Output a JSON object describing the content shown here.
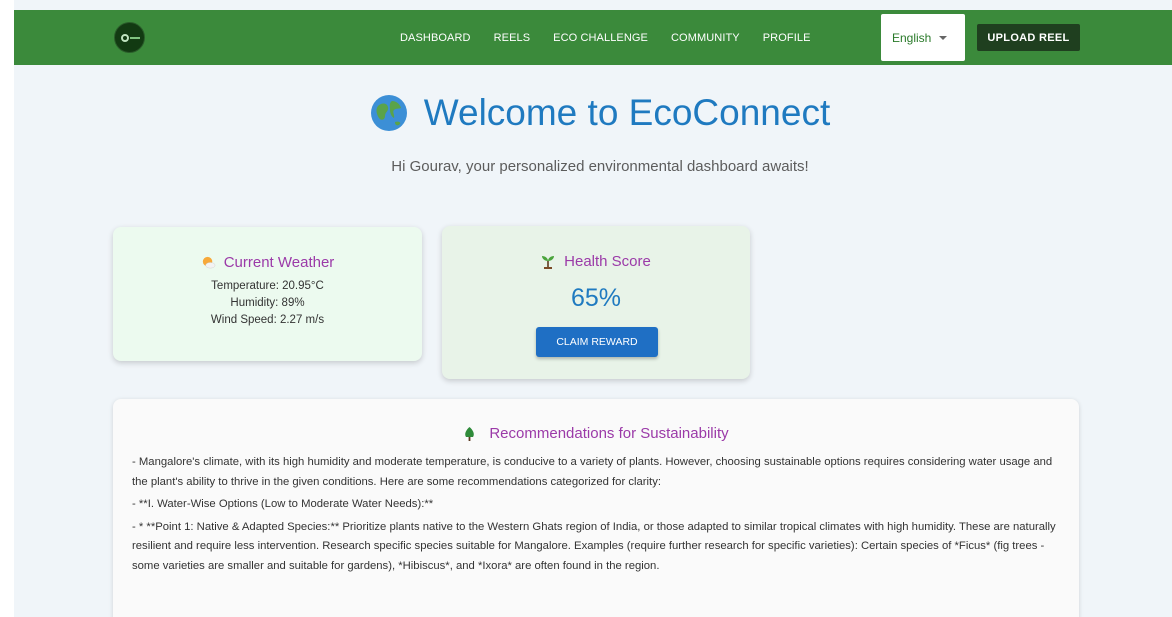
{
  "nav": {
    "links": [
      "DASHBOARD",
      "REELS",
      "ECO CHALLENGE",
      "COMMUNITY",
      "PROFILE"
    ],
    "language": "English",
    "upload_label": "UPLOAD REEL"
  },
  "hero": {
    "title": "Welcome to EcoConnect",
    "subtitle": "Hi Gourav, your personalized environmental dashboard awaits!"
  },
  "weather": {
    "heading": "Current Weather",
    "temperature": "Temperature: 20.95°C",
    "humidity": "Humidity: 89%",
    "wind": "Wind Speed: 2.27 m/s"
  },
  "health": {
    "heading": "Health Score",
    "score": "65%",
    "claim_label": "CLAIM REWARD"
  },
  "recommendations": {
    "title": "Recommendations for Sustainability",
    "paragraphs": [
      "- Mangalore's climate, with its high humidity and moderate temperature, is conducive to a variety of plants. However, choosing sustainable options requires considering water usage and the plant's ability to thrive in the given conditions. Here are some recommendations categorized for clarity:",
      "- **I. Water-Wise Options (Low to Moderate Water Needs):**",
      "- * **Point 1: Native & Adapted Species:** Prioritize plants native to the Western Ghats region of India, or those adapted to similar tropical climates with high humidity. These are naturally resilient and require less intervention. Research specific species suitable for Mangalore. Examples (require further research for specific varieties): Certain species of *Ficus* (fig trees - some varieties are smaller and suitable for gardens), *Hibiscus*, and *Ixora* are often found in the region."
    ]
  },
  "colors": {
    "nav_green": "#3b8a3b",
    "title_blue": "#1f7ac0",
    "heading_purple": "#9b3aa8",
    "button_blue": "#1f6fc4"
  },
  "icons": [
    "logo-icon",
    "globe-icon",
    "sun-cloud-icon",
    "sprout-icon",
    "tree-icon",
    "chevron-down-icon"
  ]
}
